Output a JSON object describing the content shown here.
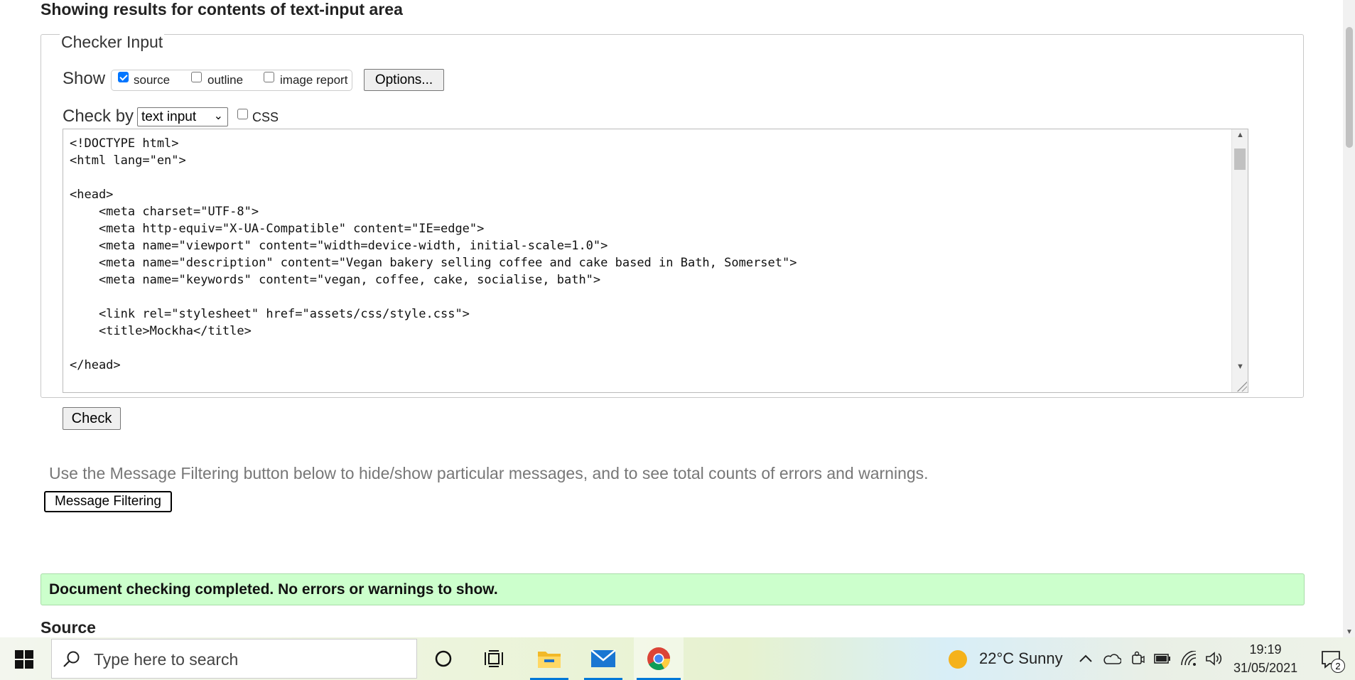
{
  "page": {
    "heading": "Showing results for contents of text-input area",
    "checker": {
      "legend": "Checker Input",
      "show_label": "Show",
      "options": [
        {
          "label": "source",
          "checked": true
        },
        {
          "label": "outline",
          "checked": false
        },
        {
          "label": "image report",
          "checked": false
        }
      ],
      "options_button": "Options...",
      "check_by_label": "Check by",
      "check_by_value": "text input",
      "css_label": "CSS",
      "css_checked": false,
      "source_code": "<!DOCTYPE html>\n<html lang=\"en\">\n\n<head>\n    <meta charset=\"UTF-8\">\n    <meta http-equiv=\"X-UA-Compatible\" content=\"IE=edge\">\n    <meta name=\"viewport\" content=\"width=device-width, initial-scale=1.0\">\n    <meta name=\"description\" content=\"Vegan bakery selling coffee and cake based in Bath, Somerset\">\n    <meta name=\"keywords\" content=\"vegan, coffee, cake, socialise, bath\">\n\n    <link rel=\"stylesheet\" href=\"assets/css/style.css\">\n    <title>Mockha</title>\n\n</head>",
      "check_button": "Check"
    },
    "filter_hint": "Use the Message Filtering button below to hide/show particular messages, and to see total counts of errors and warnings.",
    "filter_button": "Message Filtering",
    "success_message": "Document checking completed. No errors or warnings to show.",
    "source_heading": "Source"
  },
  "taskbar": {
    "search_placeholder": "Type here to search",
    "weather": "22°C  Sunny",
    "time": "19:19",
    "date": "31/05/2021",
    "notification_count": "2",
    "icons": [
      "windows-start-icon",
      "cortana-icon",
      "task-view-icon",
      "file-explorer-icon",
      "mail-icon",
      "chrome-icon",
      "weather-sun-icon",
      "chevron-up-icon",
      "onedrive-icon",
      "meet-now-icon",
      "battery-icon",
      "wifi-icon",
      "speaker-icon",
      "notification-icon"
    ],
    "accent_color": "#0078d7"
  }
}
